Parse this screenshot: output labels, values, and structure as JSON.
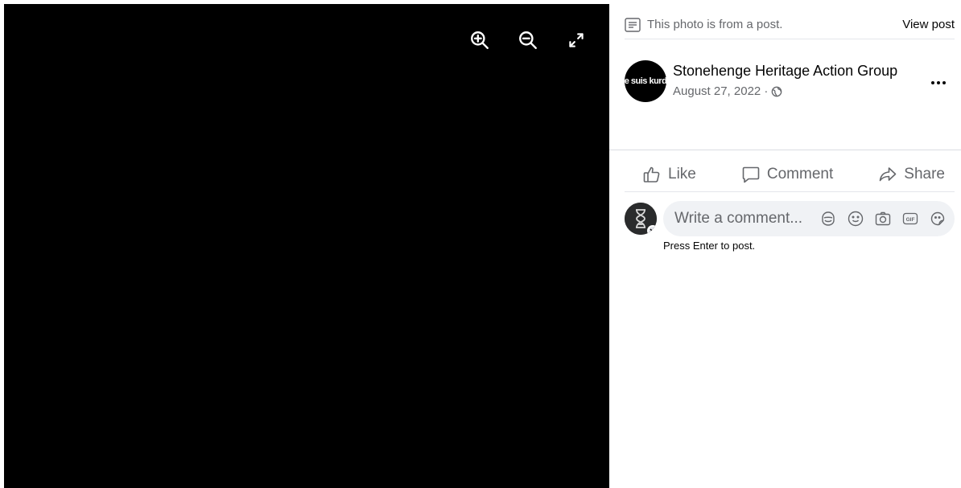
{
  "viewer": {
    "tools": [
      {
        "name": "zoom-in-icon"
      },
      {
        "name": "zoom-out-icon"
      },
      {
        "name": "fullscreen-icon"
      }
    ]
  },
  "notice": {
    "text": "This photo is from a post.",
    "icon": "post-icon",
    "view_post_label": "View post"
  },
  "author": {
    "name": "Stonehenge Heritage Action Group",
    "date": "August 27, 2022 ·",
    "avatar_text": "Je suis kurde",
    "privacy_icon": "globe-icon",
    "more_icon": "more-options-icon"
  },
  "actions": {
    "like_label": "Like",
    "comment_label": "Comment",
    "share_label": "Share"
  },
  "composer": {
    "placeholder": "Write a comment...",
    "hint": "Press Enter to post.",
    "icons": [
      "avatar-sticker-icon",
      "emoji-icon",
      "camera-icon",
      "gif-icon",
      "sticker-icon"
    ]
  },
  "colors": {
    "photo_background": "#000000",
    "secondary_text": "#65676b",
    "input_background": "#f0f2f5"
  }
}
